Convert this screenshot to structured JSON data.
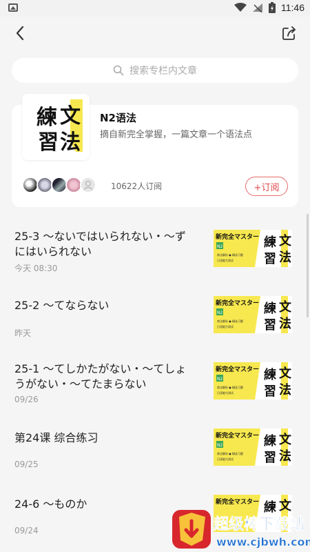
{
  "status": {
    "time": "11:46"
  },
  "search": {
    "placeholder": "搜索专栏内文章"
  },
  "column": {
    "title": "N2语法",
    "description": "摘自新完全掌握，一篇文章一个语法点",
    "subscribers": "10622人订阅",
    "subscribe_label": "+订阅",
    "cover_chars": [
      "練",
      "文",
      "習",
      "法"
    ]
  },
  "thumb": {
    "banner": "新完全マスター",
    "level": "N2",
    "chars": [
      "練",
      "文",
      "習",
      "法"
    ],
    "bullets": [
      "商法解析 ● 精选习题",
      "日语能力测试"
    ]
  },
  "articles": [
    {
      "title": "25-3 ～ないではいられない・～ずにはいられない",
      "date": "今天 08:30"
    },
    {
      "title": "25-2 ～てならない",
      "date": "昨天"
    },
    {
      "title": "25-1 ～てしかたがない・～てしょうがない・～てたまらない",
      "date": "09/26"
    },
    {
      "title": "第24课 综合练习",
      "date": "09/25"
    },
    {
      "title": "24-6 ～ものか",
      "date": "09/24"
    }
  ],
  "watermark": {
    "text": "超级棒下载站",
    "url": "www.cjbwh.com"
  },
  "colors": {
    "accent": "#e0474c",
    "yellow": "#f7e84f",
    "green": "#3aa657"
  }
}
